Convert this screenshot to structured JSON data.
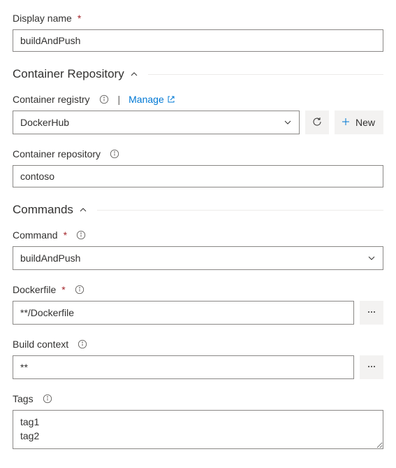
{
  "displayName": {
    "label": "Display name",
    "value": "buildAndPush"
  },
  "sections": {
    "containerRepository": {
      "title": "Container Repository"
    },
    "commands": {
      "title": "Commands"
    }
  },
  "containerRegistry": {
    "label": "Container registry",
    "manageLabel": "Manage",
    "value": "DockerHub",
    "newLabel": "New"
  },
  "containerRepository": {
    "label": "Container repository",
    "value": "contoso"
  },
  "command": {
    "label": "Command",
    "value": "buildAndPush"
  },
  "dockerfile": {
    "label": "Dockerfile",
    "value": "**/Dockerfile"
  },
  "buildContext": {
    "label": "Build context",
    "value": "**"
  },
  "tags": {
    "label": "Tags",
    "value": "tag1\ntag2"
  }
}
